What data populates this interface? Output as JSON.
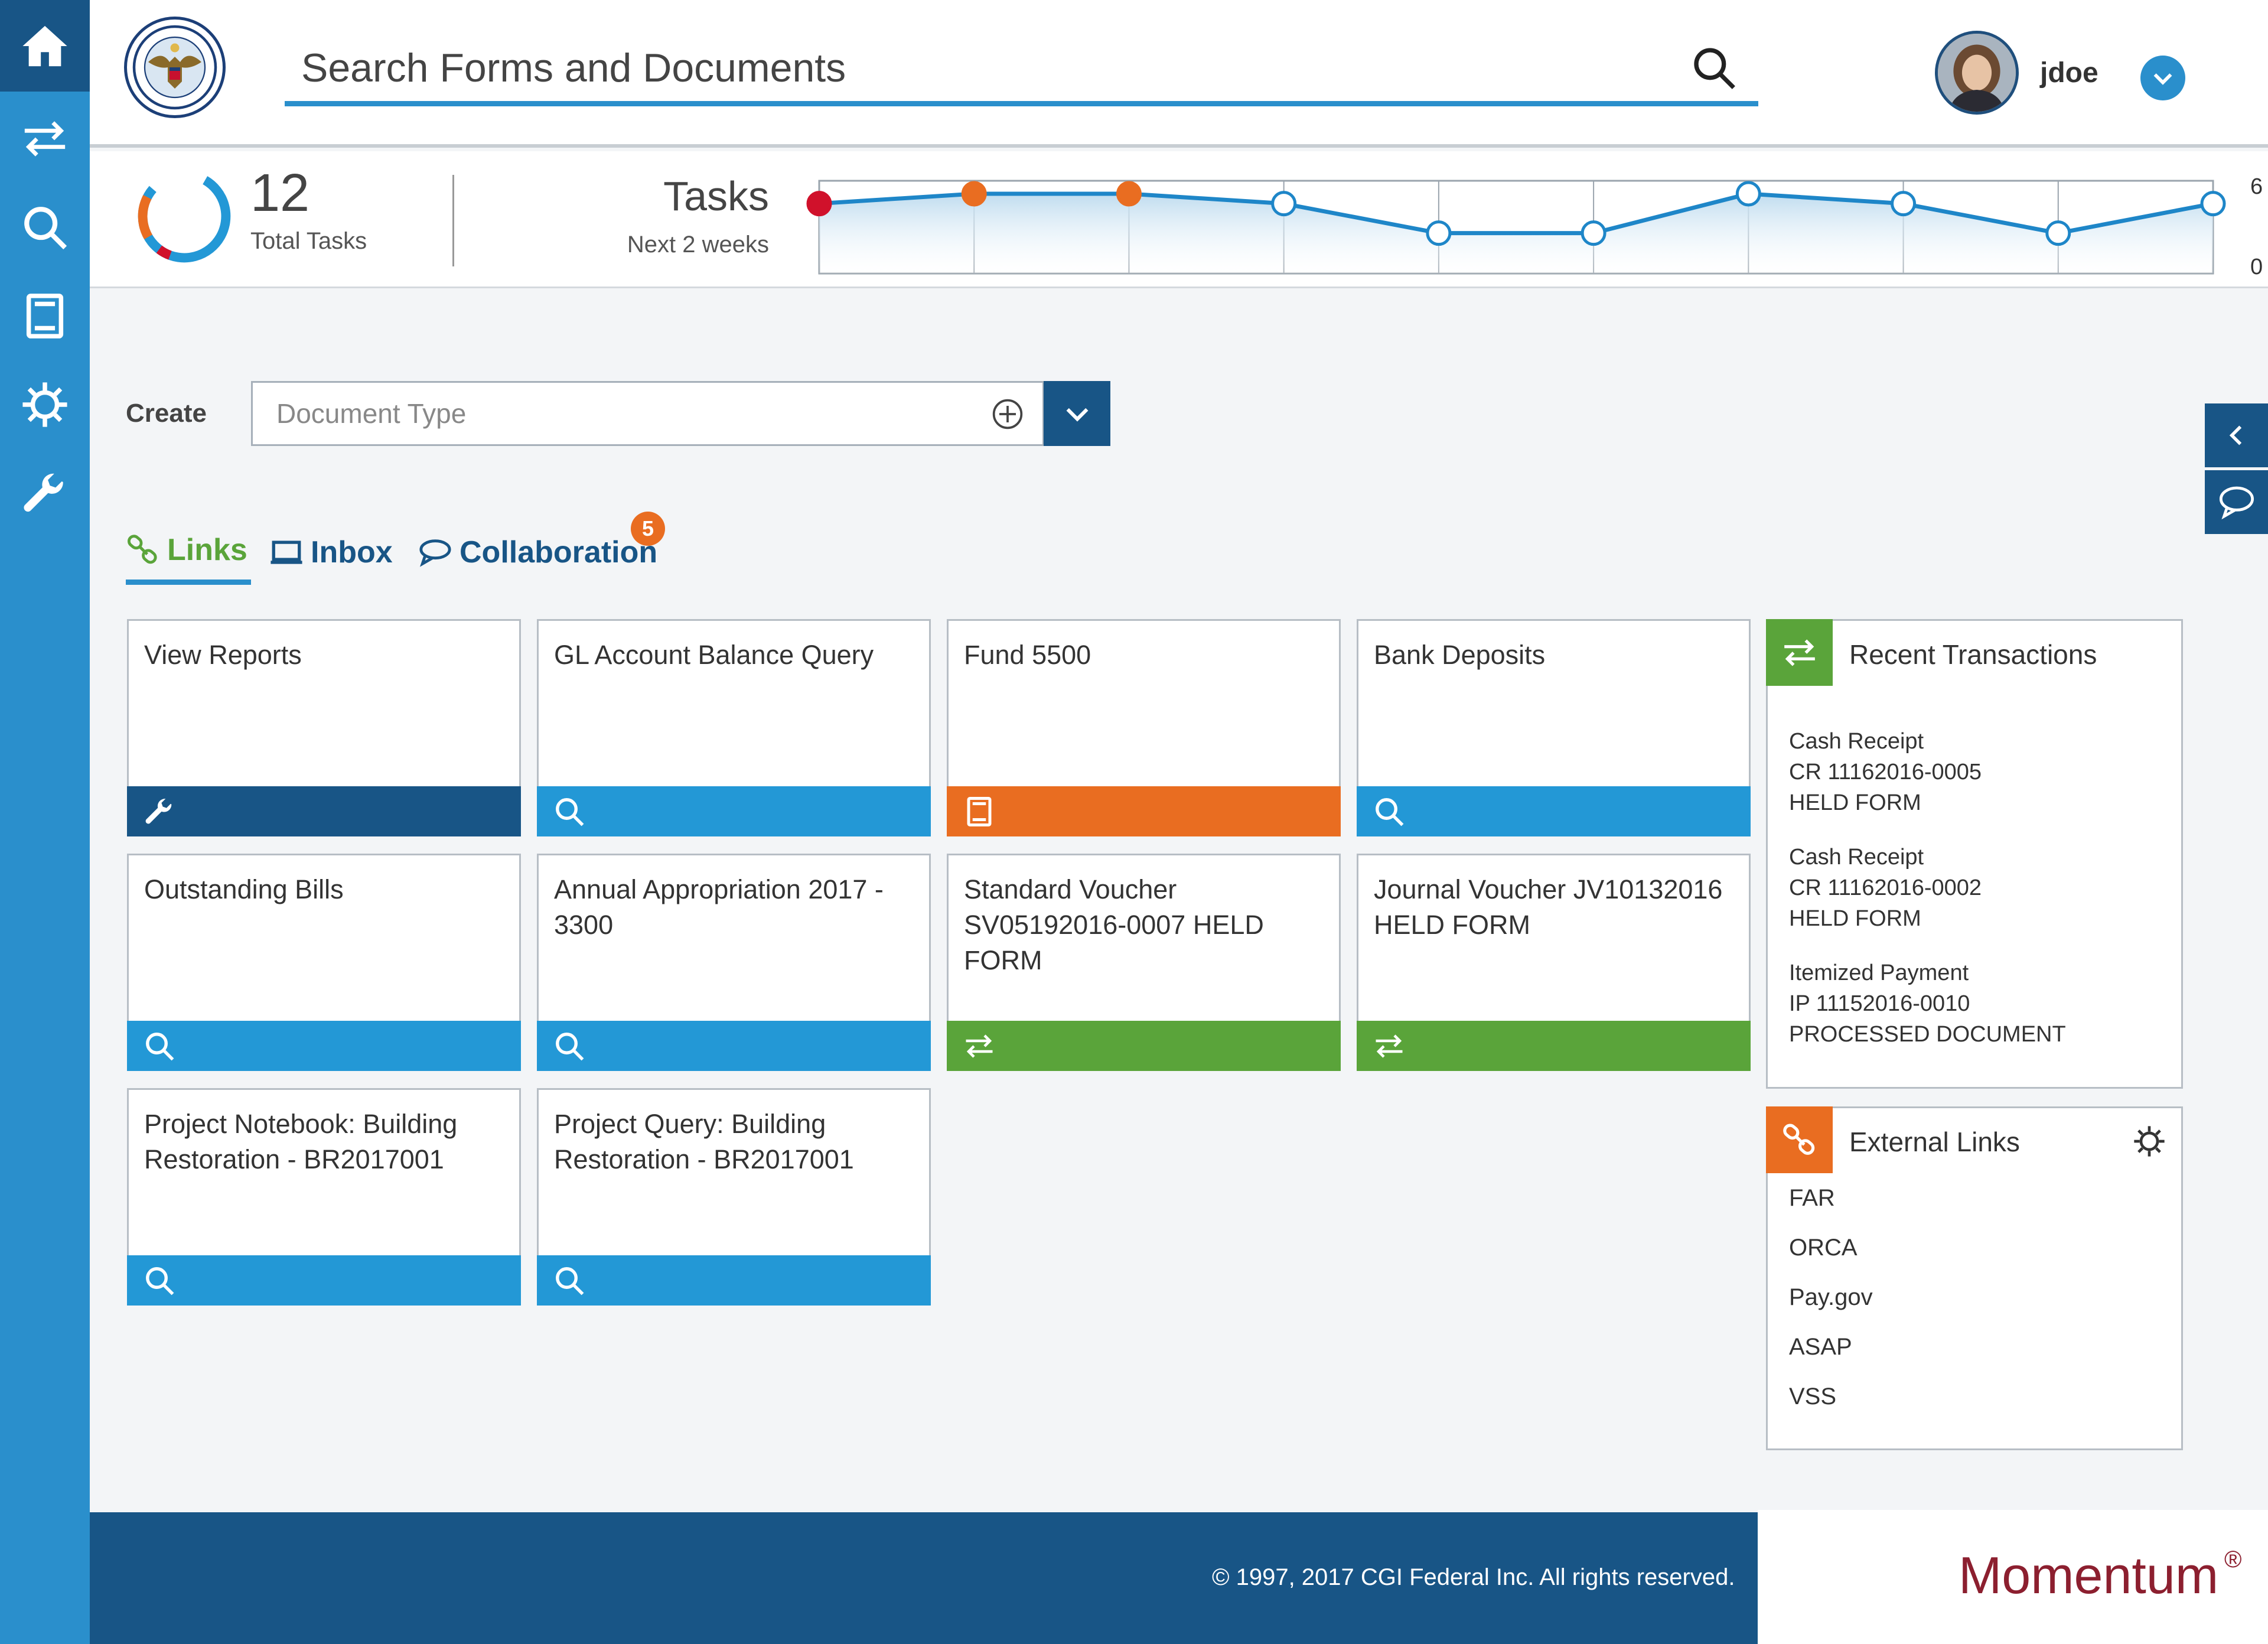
{
  "app": {
    "search": {
      "placeholder": "Search Forms and Documents"
    },
    "user": {
      "name": "jdoe"
    }
  },
  "nav": {
    "items": [
      {
        "name": "home-icon"
      },
      {
        "name": "transactions-icon"
      },
      {
        "name": "search-icon"
      },
      {
        "name": "document-icon"
      },
      {
        "name": "settings-icon"
      },
      {
        "name": "wrench-icon"
      }
    ]
  },
  "summary": {
    "total_tasks": "12",
    "total_label": "Total Tasks",
    "tasks_title": "Tasks",
    "tasks_subtitle": "Next 2 weeks",
    "spark_max": "6",
    "spark_min": "0",
    "spark_values": [
      5,
      6,
      6,
      5,
      2,
      2,
      6,
      5,
      2,
      5
    ],
    "spark_point_status": [
      "overdue",
      "due",
      "due",
      "open",
      "open",
      "open",
      "open",
      "open",
      "open",
      "open"
    ]
  },
  "create": {
    "label": "Create",
    "doc_type_placeholder": "Document Type"
  },
  "tabs": [
    {
      "label": "Links"
    },
    {
      "label": "Inbox"
    },
    {
      "label": "Collaboration"
    }
  ],
  "collab_badge": "5",
  "tiles": [
    {
      "title": "View Reports",
      "icon": "wrench-icon",
      "bar": "navy"
    },
    {
      "title": "GL Account Balance Query",
      "icon": "search-icon",
      "bar": "blue"
    },
    {
      "title": "Fund 5500",
      "icon": "document-icon",
      "bar": "orange"
    },
    {
      "title": "Bank Deposits",
      "icon": "search-icon",
      "bar": "blue"
    },
    {
      "title": "Outstanding Bills",
      "icon": "search-icon",
      "bar": "blue"
    },
    {
      "title": "Annual Appropriation 2017 - 3300",
      "icon": "search-icon",
      "bar": "blue"
    },
    {
      "title": "Standard Voucher SV05192016-0007 HELD FORM",
      "icon": "transactions-icon",
      "bar": "green"
    },
    {
      "title": "Journal Voucher JV10132016 HELD FORM",
      "icon": "transactions-icon",
      "bar": "green"
    },
    {
      "title": "Project Notebook: Building Restoration - BR2017001",
      "icon": "search-icon",
      "bar": "blue"
    },
    {
      "title": "Project Query: Building Restoration - BR2017001",
      "icon": "search-icon",
      "bar": "blue"
    }
  ],
  "recent": {
    "title": "Recent Transactions",
    "items": [
      {
        "type": "Cash Receipt",
        "id": "CR 11162016-0005",
        "status": "HELD FORM"
      },
      {
        "type": "Cash Receipt",
        "id": "CR 11162016-0002",
        "status": "HELD FORM"
      },
      {
        "type": "Itemized Payment",
        "id": "IP 11152016-0010",
        "status": "PROCESSED DOCUMENT"
      }
    ]
  },
  "external": {
    "title": "External Links",
    "links": [
      "FAR",
      "ORCA",
      "Pay.gov",
      "ASAP",
      "VSS"
    ]
  },
  "footer": {
    "copyright": "© 1997, 2017 CGI Federal Inc. All rights reserved.",
    "brand": "Momentum",
    "brand_mark": "®"
  },
  "colors": {
    "navy": "#185586",
    "blue": "#2398d6",
    "orange": "#e96d21",
    "green": "#5aa43a",
    "red": "#d0112b",
    "brand": "#8c1f2f"
  }
}
